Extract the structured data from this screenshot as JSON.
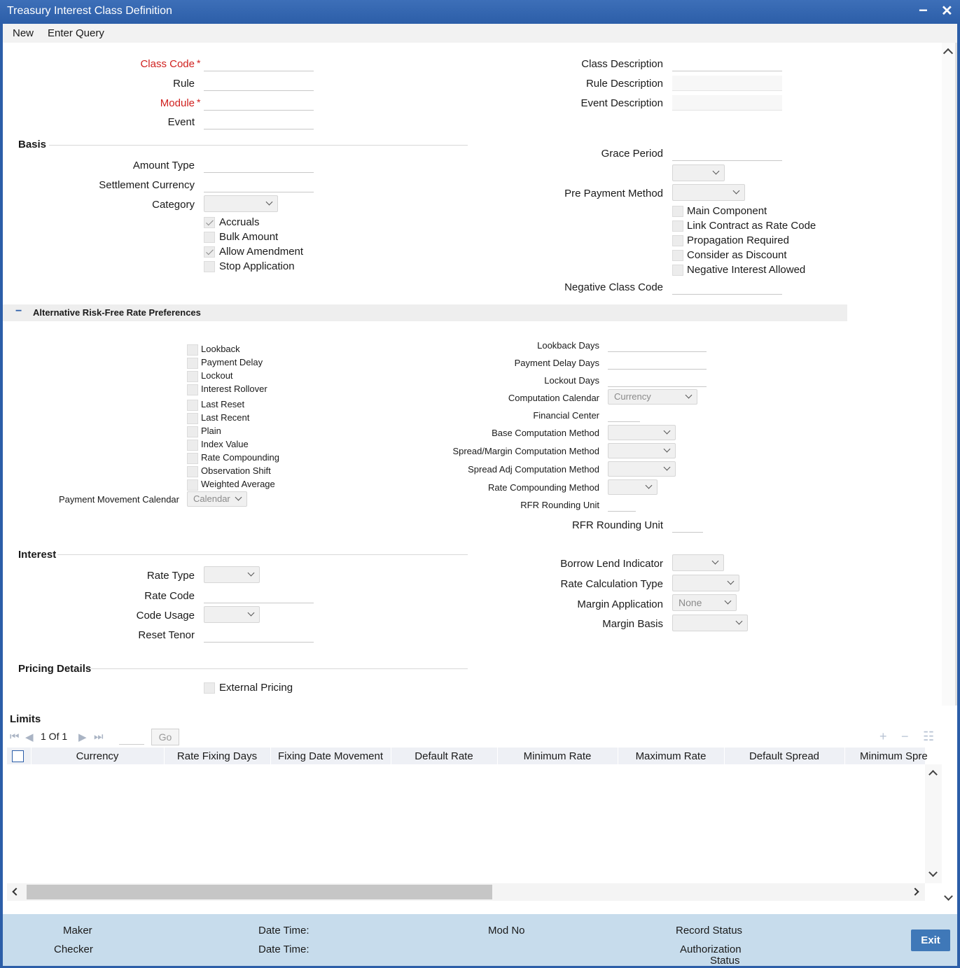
{
  "window": {
    "title": "Treasury Interest Class Definition",
    "minimize": "−",
    "close": "✕"
  },
  "menu": {
    "new": "New",
    "enter_query": "Enter Query"
  },
  "header": {
    "class_code": "Class Code",
    "rule": "Rule",
    "module": "Module",
    "event": "Event",
    "required_star": "*",
    "class_description": "Class Description",
    "rule_description": "Rule Description",
    "event_description": "Event Description"
  },
  "basis": {
    "title": "Basis",
    "amount_type": "Amount Type",
    "settlement_currency": "Settlement Currency",
    "category": "Category",
    "accruals": "Accruals",
    "bulk_amount": "Bulk Amount",
    "allow_amendment": "Allow Amendment",
    "stop_application": "Stop Application",
    "grace_period": "Grace Period",
    "pre_payment_method": "Pre Payment Method",
    "main_component": "Main Component",
    "link_contract": "Link Contract as Rate Code",
    "propagation_required": "Propagation Required",
    "consider_discount": "Consider as Discount",
    "negative_interest": "Negative Interest Allowed",
    "negative_class_code": "Negative Class Code"
  },
  "rfr": {
    "collapse": "−",
    "title": "Alternative Risk-Free Rate Preferences",
    "lookback": "Lookback",
    "payment_delay": "Payment Delay",
    "lockout": "Lockout",
    "interest_rollover": "Interest Rollover",
    "last_reset": "Last Reset",
    "last_recent": "Last Recent",
    "plain": "Plain",
    "index_value": "Index Value",
    "rate_compounding": "Rate Compounding",
    "observation_shift": "Observation Shift",
    "weighted_average": "Weighted Average",
    "payment_movement_calendar": "Payment Movement Calendar",
    "payment_movement_calendar_value": "Calendar",
    "lookback_days": "Lookback Days",
    "payment_delay_days": "Payment Delay Days",
    "lockout_days": "Lockout Days",
    "computation_calendar": "Computation Calendar",
    "computation_calendar_value": "Currency",
    "financial_center": "Financial Center",
    "base_computation_method": "Base Computation Method",
    "spread_margin_method": "Spread/Margin Computation Method",
    "spread_adj_method": "Spread Adj Computation Method",
    "rate_compounding_method": "Rate Compounding Method",
    "rfr_rounding_unit": "RFR Rounding Unit",
    "rfr_rounding_unit_2": "RFR Rounding Unit"
  },
  "interest": {
    "title": "Interest",
    "rate_type": "Rate Type",
    "rate_code": "Rate Code",
    "code_usage": "Code Usage",
    "reset_tenor": "Reset Tenor",
    "borrow_lend_indicator": "Borrow Lend Indicator",
    "rate_calculation_type": "Rate Calculation Type",
    "margin_application": "Margin Application",
    "margin_application_value": "None",
    "margin_basis": "Margin Basis"
  },
  "pricing": {
    "title": "Pricing Details",
    "external_pricing": "External Pricing"
  },
  "limits": {
    "title": "Limits",
    "pager_text": "1  Of  1",
    "go": "Go",
    "add": "+",
    "remove": "−",
    "settings": "☷",
    "columns": [
      "Currency",
      "Rate Fixing Days",
      "Fixing Date Movement",
      "Default Rate",
      "Minimum Rate",
      "Maximum Rate",
      "Default Spread",
      "Minimum Spre"
    ]
  },
  "footer": {
    "maker": "Maker",
    "checker": "Checker",
    "date_time_1": "Date Time:",
    "date_time_2": "Date Time:",
    "mod_no": "Mod No",
    "record_status": "Record Status",
    "authorization_status_1": "Authorization",
    "authorization_status_2": "Status",
    "exit": "Exit"
  },
  "colors": {
    "title_bar": "#2c5ea8",
    "required": "#d0201e",
    "footer": "#c7dcec",
    "exit_button": "#3f78b8"
  }
}
